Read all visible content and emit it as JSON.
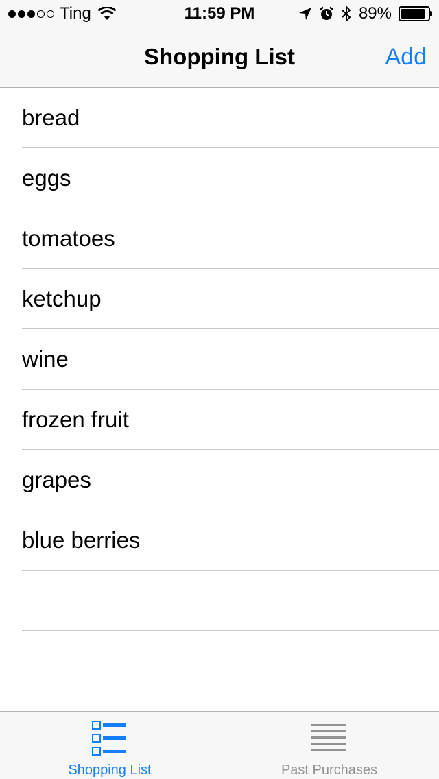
{
  "status_bar": {
    "carrier": "Ting",
    "time": "11:59 PM",
    "battery_percent": "89%",
    "battery_level": 0.89,
    "signal_bars_filled": 3,
    "signal_bars_total": 5
  },
  "nav": {
    "title": "Shopping List",
    "add_label": "Add"
  },
  "items": [
    {
      "label": "bread"
    },
    {
      "label": "eggs"
    },
    {
      "label": "tomatoes"
    },
    {
      "label": "ketchup"
    },
    {
      "label": "wine"
    },
    {
      "label": "frozen fruit"
    },
    {
      "label": "grapes"
    },
    {
      "label": "blue berries"
    },
    {
      "label": ""
    },
    {
      "label": ""
    }
  ],
  "tabs": [
    {
      "label": "Shopping List",
      "icon": "checklist-icon",
      "selected": true
    },
    {
      "label": "Past Purchases",
      "icon": "lines-icon",
      "selected": false
    }
  ],
  "colors": {
    "accent": "#157efb",
    "inactive": "#929292",
    "bar_background": "#f7f7f7",
    "separator": "#c8c7cc"
  }
}
